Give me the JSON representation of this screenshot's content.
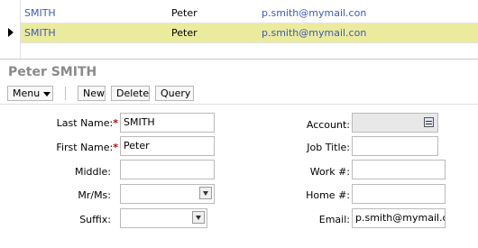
{
  "list": {
    "rows": [
      {
        "last_name": "SMITH",
        "first_name": "Peter",
        "email": "p.smith@mymail.con",
        "selected": false
      },
      {
        "last_name": "SMITH",
        "first_name": "Peter",
        "email": "p.smith@mymail.con",
        "selected": true
      }
    ]
  },
  "form": {
    "title": "Peter SMITH",
    "toolbar": {
      "menu_label": "Menu",
      "new_label": "New",
      "delete_label": "Delete",
      "query_label": "Query"
    },
    "left_fields": {
      "last_name": {
        "label": "Last Name:",
        "required": "*",
        "value": "SMITH"
      },
      "first_name": {
        "label": "First Name:",
        "required": "*",
        "value": "Peter"
      },
      "middle": {
        "label": "Middle:",
        "value": ""
      },
      "mr_ms": {
        "label": "Mr/Ms:",
        "value": ""
      },
      "suffix": {
        "label": "Suffix:",
        "value": ""
      }
    },
    "right_fields": {
      "account": {
        "label": "Account:",
        "value": ""
      },
      "job_title": {
        "label": "Job Title:",
        "value": ""
      },
      "work_phone": {
        "label": "Work #:",
        "value": ""
      },
      "home_phone": {
        "label": "Home #:",
        "value": ""
      },
      "email": {
        "label": "Email:",
        "value": "p.smith@mymail.com"
      }
    }
  },
  "colors": {
    "selected_row": "#ebeb9d",
    "link_text": "#3b5bb5",
    "required_mark": "#c00000",
    "title_text": "#8a8a8a"
  }
}
